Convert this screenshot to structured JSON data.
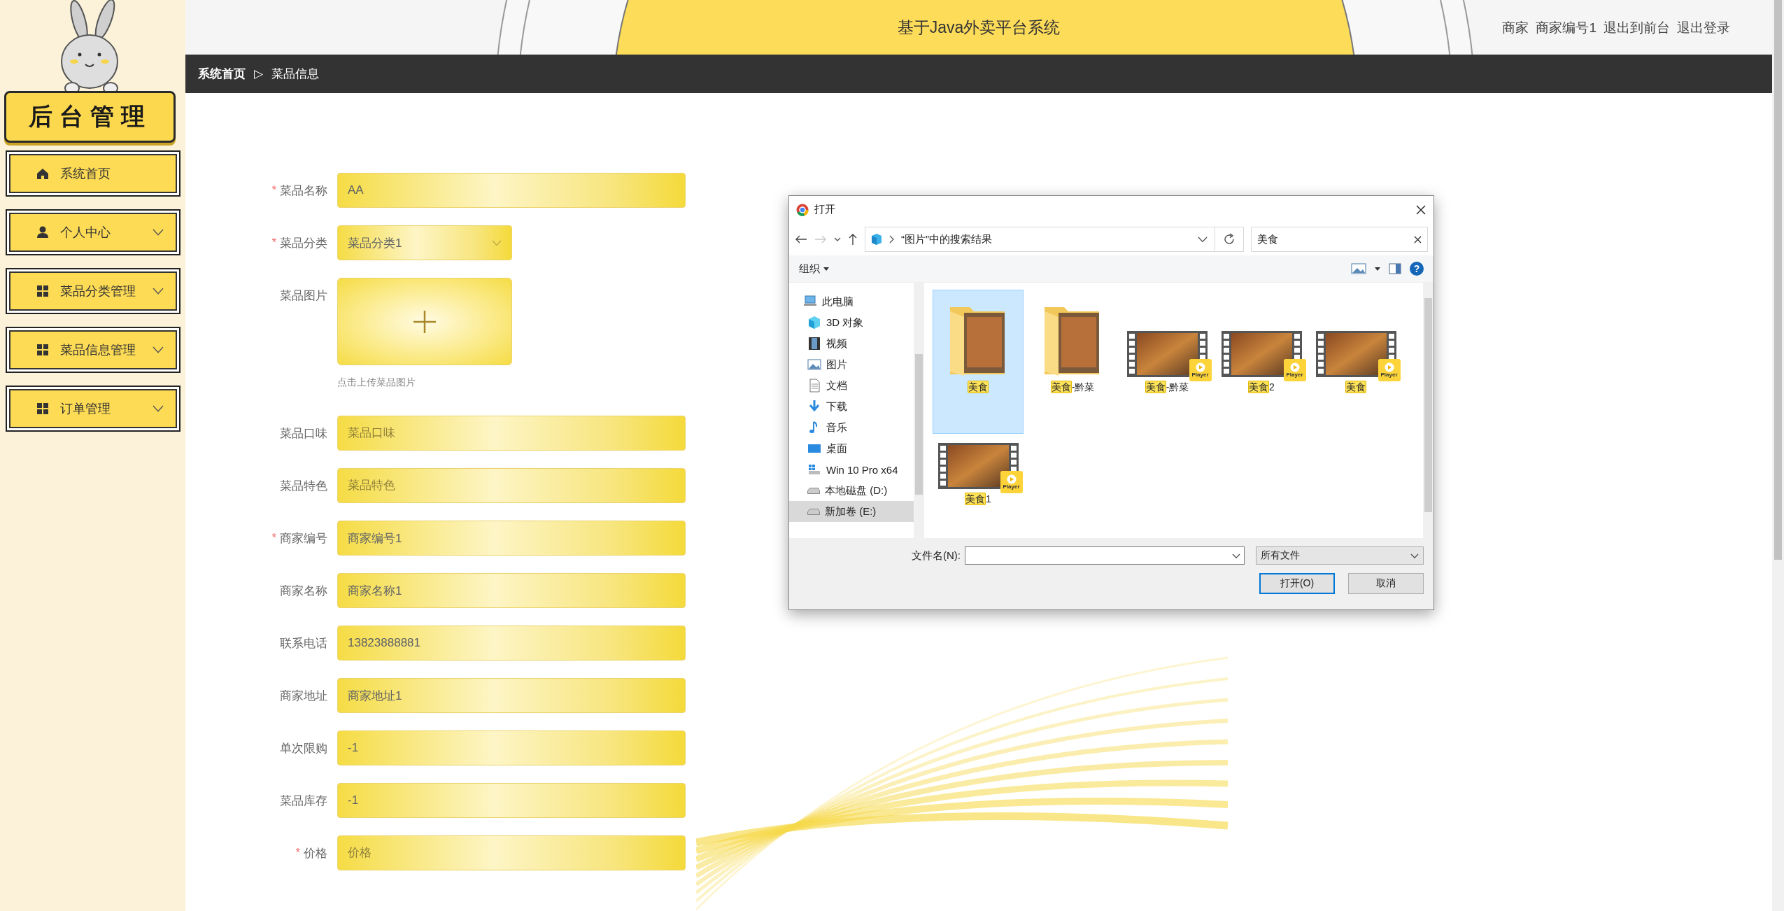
{
  "sidebar": {
    "title": "后台管理",
    "items": [
      {
        "label": "系统首页",
        "kind": "home",
        "expandable": false
      },
      {
        "label": "个人中心",
        "kind": "user",
        "expandable": true
      },
      {
        "label": "菜品分类管理",
        "kind": "grid",
        "expandable": true
      },
      {
        "label": "菜品信息管理",
        "kind": "grid",
        "expandable": true
      },
      {
        "label": "订单管理",
        "kind": "grid",
        "expandable": true
      }
    ]
  },
  "header": {
    "title": "基于Java外卖平台系统",
    "role": "商家",
    "user": "商家编号1",
    "links": [
      "退出到前台",
      "退出登录"
    ]
  },
  "breadcrumb": {
    "separator": "▷",
    "items": [
      "系统首页",
      "菜品信息"
    ]
  },
  "form": {
    "required_mark": "*",
    "fields": [
      {
        "label": "菜品名称",
        "required": true,
        "kind": "text",
        "value": "AA"
      },
      {
        "label": "菜品分类",
        "required": true,
        "kind": "select",
        "value": "菜品分类1"
      },
      {
        "label": "菜品图片",
        "required": false,
        "kind": "upload",
        "hint": "点击上传菜品图片"
      },
      {
        "label": "菜品口味",
        "required": false,
        "kind": "text",
        "placeholder": "菜品口味"
      },
      {
        "label": "菜品特色",
        "required": false,
        "kind": "text",
        "placeholder": "菜品特色"
      },
      {
        "label": "商家编号",
        "required": true,
        "kind": "text",
        "value": "商家编号1"
      },
      {
        "label": "商家名称",
        "required": false,
        "kind": "text",
        "value": "商家名称1"
      },
      {
        "label": "联系电话",
        "required": false,
        "kind": "text",
        "value": "13823888881"
      },
      {
        "label": "商家地址",
        "required": false,
        "kind": "text",
        "value": "商家地址1"
      },
      {
        "label": "单次限购",
        "required": false,
        "kind": "text",
        "value": "-1"
      },
      {
        "label": "菜品库存",
        "required": false,
        "kind": "text",
        "value": "-1"
      },
      {
        "label": "价格",
        "required": true,
        "kind": "text",
        "placeholder": "价格"
      }
    ]
  },
  "dialog": {
    "title": "打开",
    "forward_disabled": true,
    "address": "“图片”中的搜索结果",
    "search": "美食",
    "organize": "组织",
    "help": "?",
    "nav": [
      {
        "label": "此电脑",
        "kind": "pc",
        "selected": false,
        "children": [
          {
            "label": "3D 对象",
            "kind": "cube",
            "selected": false
          },
          {
            "label": "视频",
            "kind": "video",
            "selected": false
          },
          {
            "label": "图片",
            "kind": "picture",
            "selected": false
          },
          {
            "label": "文档",
            "kind": "document",
            "selected": false
          },
          {
            "label": "下载",
            "kind": "download",
            "selected": false
          },
          {
            "label": "音乐",
            "kind": "music",
            "selected": false
          },
          {
            "label": "桌面",
            "kind": "desktop",
            "selected": false
          },
          {
            "label": "Win 10 Pro x64",
            "kind": "windrive",
            "selected": false
          },
          {
            "label": "本地磁盘 (D:)",
            "kind": "drive",
            "selected": false
          },
          {
            "label": "新加卷 (E:)",
            "kind": "drive",
            "selected": true
          }
        ]
      }
    ],
    "files": [
      {
        "kind": "folder",
        "match": "美食",
        "selected": true
      },
      {
        "kind": "folder",
        "match": "美食",
        "rest": "-黔菜",
        "selected": false
      },
      {
        "kind": "video",
        "match": "美食",
        "rest": "-黔菜",
        "badge": "Player",
        "selected": false
      },
      {
        "kind": "video",
        "match": "美食",
        "rest": "2",
        "badge": "Player",
        "selected": false
      },
      {
        "kind": "video",
        "match": "美食",
        "badge": "Player",
        "selected": false
      },
      {
        "kind": "video",
        "match": "美食",
        "rest": "1",
        "badge": "Player",
        "selected": false
      }
    ],
    "filename_label": "文件名(N):",
    "filetype": "所有文件",
    "buttons": [
      {
        "label": "打开(O)",
        "default": true
      },
      {
        "label": "取消",
        "default": false
      }
    ]
  }
}
